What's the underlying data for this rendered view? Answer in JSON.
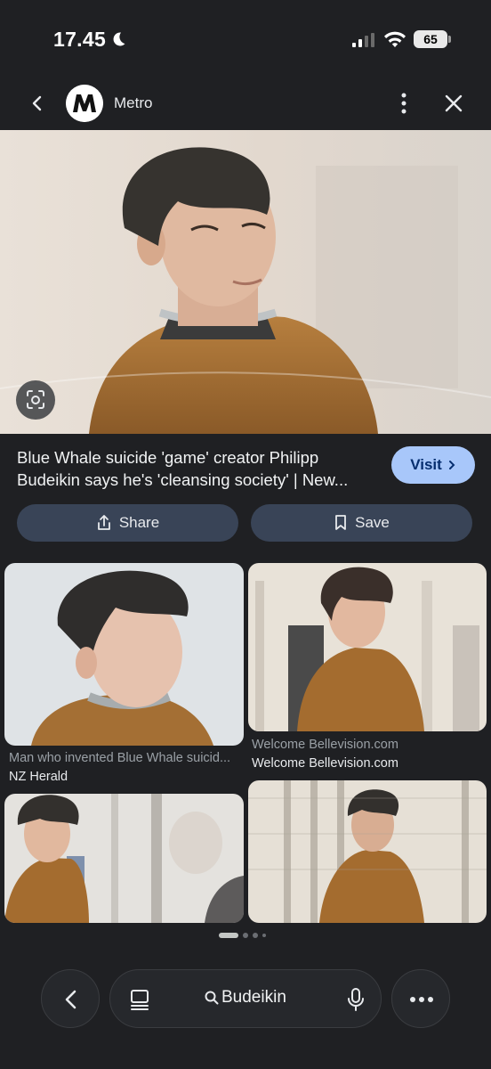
{
  "status_bar": {
    "time": "17.45",
    "battery": "65"
  },
  "header": {
    "source": "Metro"
  },
  "result": {
    "title": "Blue Whale suicide 'game' creator Philipp Budeikin says he's 'cleansing society' | New...",
    "visit_label": "Visit",
    "share_label": "Share",
    "save_label": "Save"
  },
  "related": [
    {
      "caption": "Man who invented Blue Whale suicid...",
      "source": "NZ Herald"
    },
    {
      "caption": "Welcome Bellevision.com",
      "source": "Welcome Bellevision.com"
    },
    {
      "caption": "",
      "source": ""
    },
    {
      "caption": "",
      "source": ""
    }
  ],
  "bottom_bar": {
    "query": "Budeikin"
  },
  "colors": {
    "accent": "#a8c7fa",
    "button": "#394457",
    "background": "#1f2023"
  }
}
